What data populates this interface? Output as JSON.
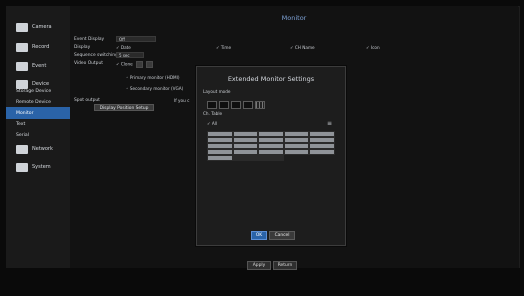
{
  "sidebar": {
    "items": [
      {
        "label": "Camera",
        "icon": "camera-icon"
      },
      {
        "label": "Record",
        "icon": "record-icon"
      },
      {
        "label": "Event",
        "icon": "event-icon"
      },
      {
        "label": "Device",
        "icon": "device-icon"
      },
      {
        "label": "Network",
        "icon": "network-icon"
      },
      {
        "label": "System",
        "icon": "system-icon"
      }
    ],
    "device_sub": [
      "Storage Device",
      "Remote Device",
      "Monitor",
      "Text",
      "Serial"
    ],
    "active_sub": "Monitor"
  },
  "main": {
    "title": "Monitor",
    "event_display_label": "Event Display",
    "event_display_value": "Off",
    "display_label": "Display",
    "display_options": [
      {
        "label": "Date",
        "checked": true
      },
      {
        "label": "Time",
        "checked": true
      },
      {
        "label": "CH Name",
        "checked": true
      },
      {
        "label": "Icon",
        "checked": true
      }
    ],
    "sequence_label": "Sequence switching time",
    "sequence_value": "5 sec",
    "video_output_label": "Video Output",
    "video_output_clone": "Clone",
    "primary_monitor": "Primary monitor (HDMI)",
    "secondary_monitor": "Secondary monitor (VGA)",
    "spot_output_label": "Spot output",
    "spot_output_extra": "If you c",
    "display_position_setup": "Display Position Setup"
  },
  "modal": {
    "title": "Extended Monitor Settings",
    "layout_mode_label": "Layout mode",
    "ch_table_label": "Ch. Table",
    "all_label": "All",
    "ok_label": "OK",
    "cancel_label": "Cancel"
  },
  "footer": {
    "apply_label": "Apply",
    "return_label": "Return"
  },
  "colors": {
    "accent": "#2a63a8",
    "title": "#7ea2d6"
  }
}
